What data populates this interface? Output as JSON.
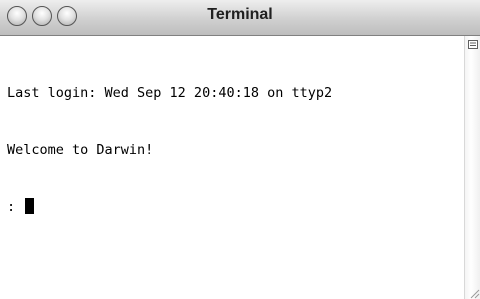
{
  "window": {
    "title": "Terminal"
  },
  "terminal": {
    "lines": [
      "Last login: Wed Sep 12 20:40:18 on ttyp2",
      "Welcome to Darwin!"
    ],
    "prompt": ":"
  },
  "icons": {
    "close": "close-button-circle",
    "minimize": "minimize-button-circle",
    "zoom": "zoom-button-circle",
    "split": "split-pane-handle",
    "resize": "resize-grip"
  }
}
